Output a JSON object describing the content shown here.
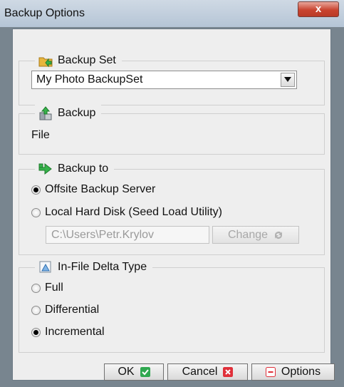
{
  "window": {
    "title": "Backup Options",
    "close_glyph": "x"
  },
  "backup_set": {
    "legend": "Backup Set",
    "icon": "folder-arrow-icon",
    "selected": "My Photo BackupSet"
  },
  "backup": {
    "legend": "Backup",
    "icon": "backup-source-icon",
    "value": "File"
  },
  "backup_to": {
    "legend": "Backup to",
    "icon": "green-arrow-icon",
    "options": [
      {
        "label": "Offsite Backup Server",
        "selected": true
      },
      {
        "label": "Local Hard Disk (Seed Load Utility)",
        "selected": false
      }
    ],
    "path_value": "C:\\Users\\Petr.Krylov",
    "change_label": "Change"
  },
  "delta": {
    "legend": "In-File Delta Type",
    "icon": "delta-icon",
    "options": [
      {
        "label": "Full",
        "selected": false
      },
      {
        "label": "Differential",
        "selected": false
      },
      {
        "label": "Incremental",
        "selected": true
      }
    ]
  },
  "buttons": {
    "ok": "OK",
    "cancel": "Cancel",
    "options": "Options"
  },
  "colors": {
    "ok_badge": "#2fa84f",
    "cancel_badge": "#e0303a",
    "options_badge": "#e0303a"
  }
}
